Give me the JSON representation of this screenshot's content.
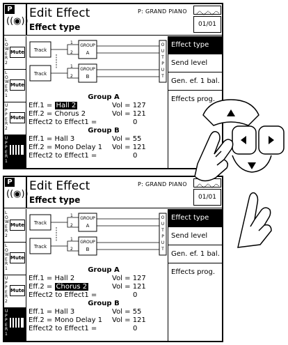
{
  "header": {
    "badge": "P",
    "title": "Edit Effect",
    "subtitle": "Effect type",
    "preset": "P: GRAND PIANO",
    "page": "01/01"
  },
  "sidebar": {
    "slots": [
      {
        "label": "LOWER 2",
        "button": "Mute"
      },
      {
        "label": "LOWER 1",
        "button": "Mute"
      },
      {
        "label": "UPPER 2",
        "button": "Mute"
      },
      {
        "label": "UPPER 1",
        "button": "keyboard-icon"
      }
    ]
  },
  "diagram": {
    "track": "Track",
    "group_a": "GROUP A",
    "group_b": "GROUP B",
    "output": "OUTPUT",
    "n1": "1",
    "n2": "2"
  },
  "menu": {
    "items": [
      "Effect type",
      "Send level",
      "Gen. ef. 1 bal.",
      "Effects prog."
    ]
  },
  "params": {
    "group_a": {
      "title": "Group A",
      "eff1": {
        "label": "Eff.1 =",
        "value": "Hall 2",
        "vol": "Vol = 127"
      },
      "eff2": {
        "label": "Eff.2 =",
        "value": "Chorus 2",
        "vol": "Vol = 121"
      },
      "send": {
        "label": "Effect2 to Effect1 =",
        "value": "0"
      }
    },
    "group_b": {
      "title": "Group B",
      "eff1": {
        "label": "Eff.1 =",
        "value": "Hall 3",
        "vol": "Vol = 55"
      },
      "eff2": {
        "label": "Eff.2 =",
        "value": "Mono Delay 1",
        "vol": "Vol = 121"
      },
      "send": {
        "label": "Effect2 to Effect1 =",
        "value": "0"
      }
    }
  },
  "screens": [
    {
      "highlighted_param": "group_a.eff1"
    },
    {
      "highlighted_param": "group_a.eff2"
    }
  ],
  "colors": {
    "ink": "#000000",
    "paper": "#ffffff"
  }
}
